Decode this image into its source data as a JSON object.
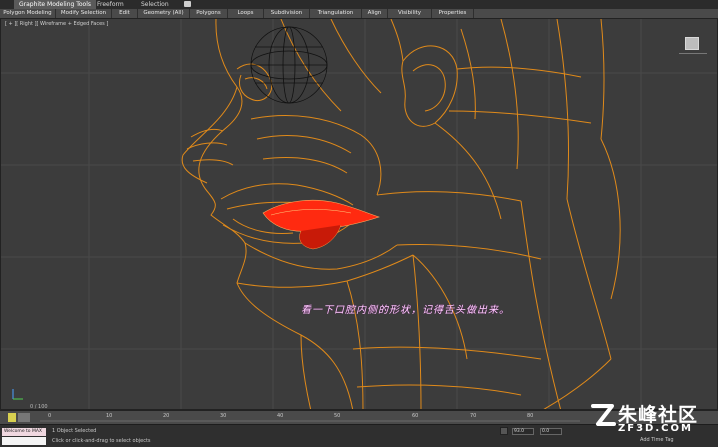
{
  "ribbon_tabs": [
    {
      "label": "Graphite Modeling Tools",
      "active": true
    },
    {
      "label": "Freeform",
      "active": false
    },
    {
      "label": "Selection",
      "active": false
    }
  ],
  "ribbon_panels": [
    "Polygon Modeling",
    "Modify Selection",
    "Edit",
    "Geometry (All)",
    "Polygons",
    "Loops",
    "Subdivision",
    "Triangulation",
    "Align",
    "Visibility",
    "Properties"
  ],
  "viewport": {
    "label": "[ + ][ Right ][ Wireframe + Edged Faces ]",
    "caption": "看一下口腔内侧的形状，记得舌头做出来。",
    "frame_readout": "0 / 100"
  },
  "timeline": {
    "ticks": [
      "0",
      "10",
      "20",
      "30",
      "40",
      "50",
      "60",
      "70",
      "80"
    ]
  },
  "status": {
    "script_text": "Welcome to MAX",
    "line1": "1 Object Selected",
    "line2": "Click or click-and-drag to select objects",
    "x_value": "93.0",
    "y_value": "0.0",
    "add_time_tag": "Add Time Tag"
  },
  "watermark": {
    "text": "朱峰社区",
    "url": "ZF3D.COM"
  },
  "colors": {
    "wire": "#e08a1a",
    "selection": "#ff2a10",
    "caption": "#ffd0ff"
  }
}
